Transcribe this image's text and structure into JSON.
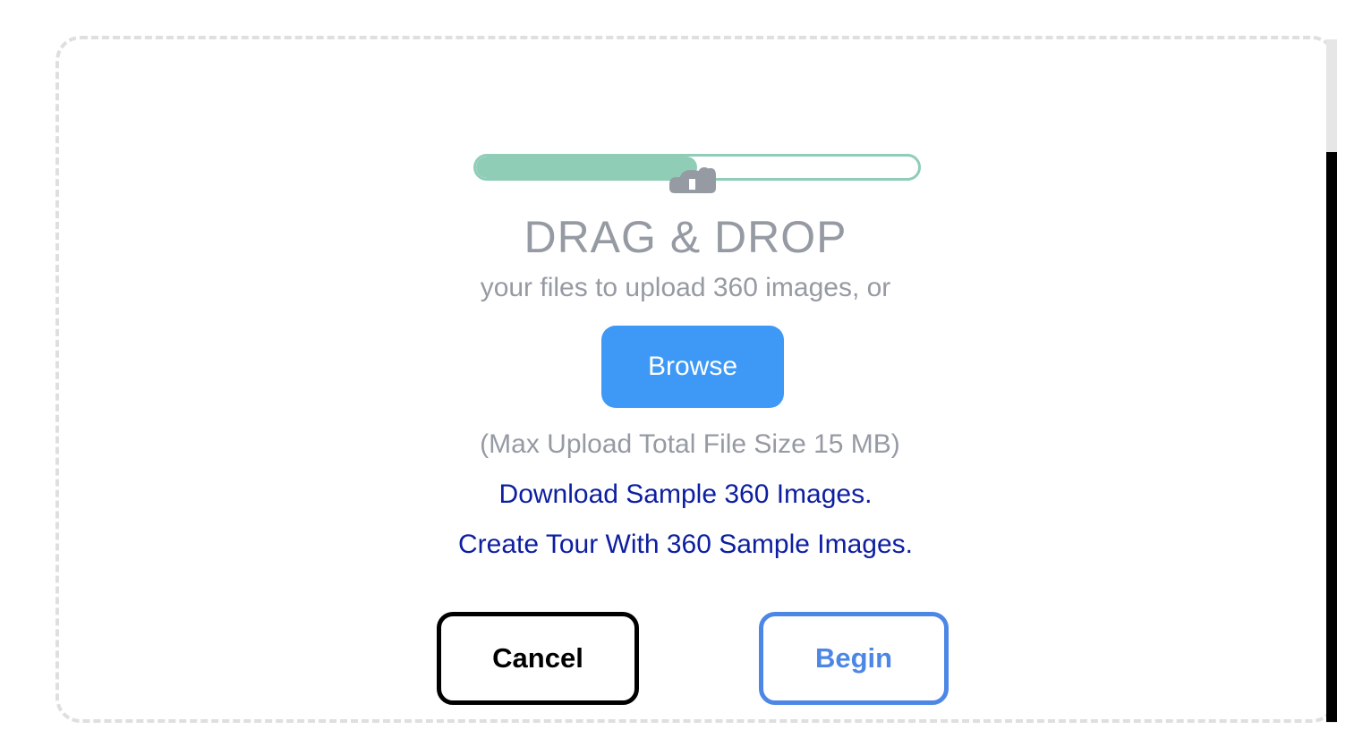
{
  "upload": {
    "progress_fraction": 0.5,
    "title": "DRAG & DROP",
    "subtitle": "your files to upload 360 images, or",
    "browse_label": "Browse",
    "max_size_note": "(Max Upload Total File Size 15 MB)",
    "sample_download_link": "Download Sample 360 Images.",
    "sample_tour_link": "Create Tour With 360 Sample Images."
  },
  "actions": {
    "cancel_label": "Cancel",
    "begin_label": "Begin"
  },
  "colors": {
    "progress": "#8fcdb7",
    "browse_bg": "#3d99f5",
    "link": "#0d1ea1",
    "muted_text": "#959aa3",
    "begin_accent": "#4d87e6"
  },
  "icons": {
    "upload": "cloud-upload-icon"
  }
}
